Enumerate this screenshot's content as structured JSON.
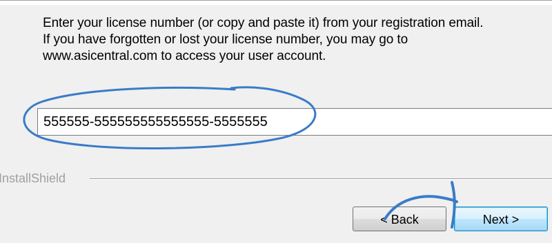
{
  "instructions": {
    "line1": "Enter your license number (or copy and paste it) from your registration email.",
    "line2": "If you have forgotten or lost your license number, you may go to",
    "line3": "www.asicentral.com to access your user account."
  },
  "license": {
    "value": "555555-555555555555555-5555555"
  },
  "footer": {
    "brand_label": "InstallShield"
  },
  "buttons": {
    "back_label": "< Back",
    "next_label": "Next >"
  },
  "colors": {
    "annotation": "#3a7bc8",
    "separator": "#a0a0a0",
    "background": "#f0f0f0"
  }
}
